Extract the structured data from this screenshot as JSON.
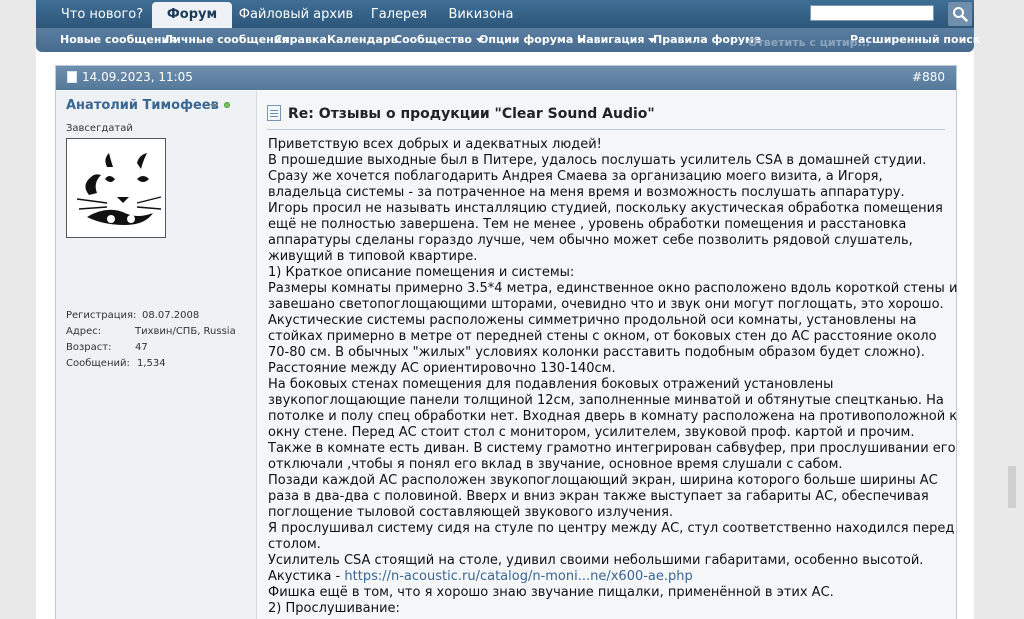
{
  "nav": {
    "tabs": [
      "Что нового?",
      "Форум",
      "Файловый архив",
      "Галерея",
      "Викизона"
    ],
    "active_tab": "Форум"
  },
  "subnav": {
    "items": [
      {
        "label": "Новые сообщения",
        "dropdown": false
      },
      {
        "label": "Личные сообщения",
        "dropdown": false
      },
      {
        "label": "Справка",
        "dropdown": false
      },
      {
        "label": "Календарь",
        "dropdown": false
      },
      {
        "label": "Сообщество",
        "dropdown": true
      },
      {
        "label": "Опции форума",
        "dropdown": true
      },
      {
        "label": "Навигация",
        "dropdown": true
      },
      {
        "label": "Правила форума",
        "dropdown": false
      }
    ],
    "ghost_text": "Ответить с цитир...",
    "advanced_search": "Расширенный поиск"
  },
  "post": {
    "date": "14.09.2023, 11:05",
    "number": "#880",
    "title": "Re: Отзывы о продукции \"Clear Sound Audio\"",
    "user": {
      "name": "Анатолий Тимофеев",
      "title": "Завсегдатай",
      "stats": [
        {
          "label": "Регистрация:",
          "value": "08.07.2008"
        },
        {
          "label": "Адрес:",
          "value": "Тихвин/СПБ, Russia"
        },
        {
          "label": "Возраст:",
          "value": "47"
        },
        {
          "label": "Сообщений:",
          "value": "1,534"
        }
      ]
    },
    "lines": [
      "Приветствую всех добрых и адекватных людей!",
      "В прошедшие выходные был в Питере, удалось послушать усилитель CSA в домашней студии.",
      "Сразу же хочется поблагодарить Андрея Смаева за организацию моего визита, а Игоря,",
      "владельца системы - за потраченное на меня время и возможность послушать аппаратуру.",
      "Игорь просил не называть инсталляцию студией, поскольку акустическая обработка помещения",
      "ещё не полностью завершена. Тем не менее , уровень обработки помещения и расстановка",
      "аппаратуры сделаны гораздо лучше, чем обычно может себе позволить рядовой слушатель,",
      "живущий в типовой квартире.",
      "1) Краткое описание помещения и системы:",
      "Размеры комнаты примерно 3.5*4 метра, единственное окно расположено вдоль короткой стены и",
      "завешано светопоглощающими шторами, очевидно что и звук они могут поглощать, это хорошо.",
      "Акустические системы расположены симметрично продольной оси комнаты, установлены на",
      "стойках примерно в метре от передней стены с окном, от боковых стен до АС расстояние около",
      "70-80 см. В обычных \"жилых\" условиях колонки расставить подобным образом будет сложно).",
      "Расстояние между АС ориентировочно 130-140см.",
      "На боковых стенах помещения для подавления боковых отражений установлены",
      "звукопоглощающие панели толщиной 12см, заполненные минватой и обтянутые спецтканью. На",
      "потолке и полу спец обработки нет. Входная дверь в комнату расположена на противоположной к",
      "окну стене. Перед АС стоит стол с монитором, усилителем, звуковой проф. картой и прочим.",
      "Также в комнате есть диван. В систему грамотно интегрирован сабвуфер, при прослушивании его",
      "отключали ,чтобы я понял его вклад в звучание, основное время слушали с сабом.",
      "Позади каждой АС расположен звукопоглощающий экран, ширина которого больше ширины АС",
      "раза в два-два с половиной. Вверх и вниз экран также выступает за габариты АС, обеспечивая",
      "поглощение тыловой составляющей звукового излучения.",
      "Я прослушивал систему сидя на стуле по центру между АС, стул соответственно находился перед",
      "столом.",
      "Усилитель CSA стоящий на столе, удивил своими небольшими габаритами, особенно высотой."
    ],
    "link_prefix": "Акустика - ",
    "link_text": "https://n-acoustic.ru/catalog/n-moni...ne/x600-ae.php",
    "lines_after": [
      "Фишка ещё в том, что я хорошо знаю звучание пищалки, применённой в этих АС.",
      "2) Прослушивание:"
    ]
  }
}
